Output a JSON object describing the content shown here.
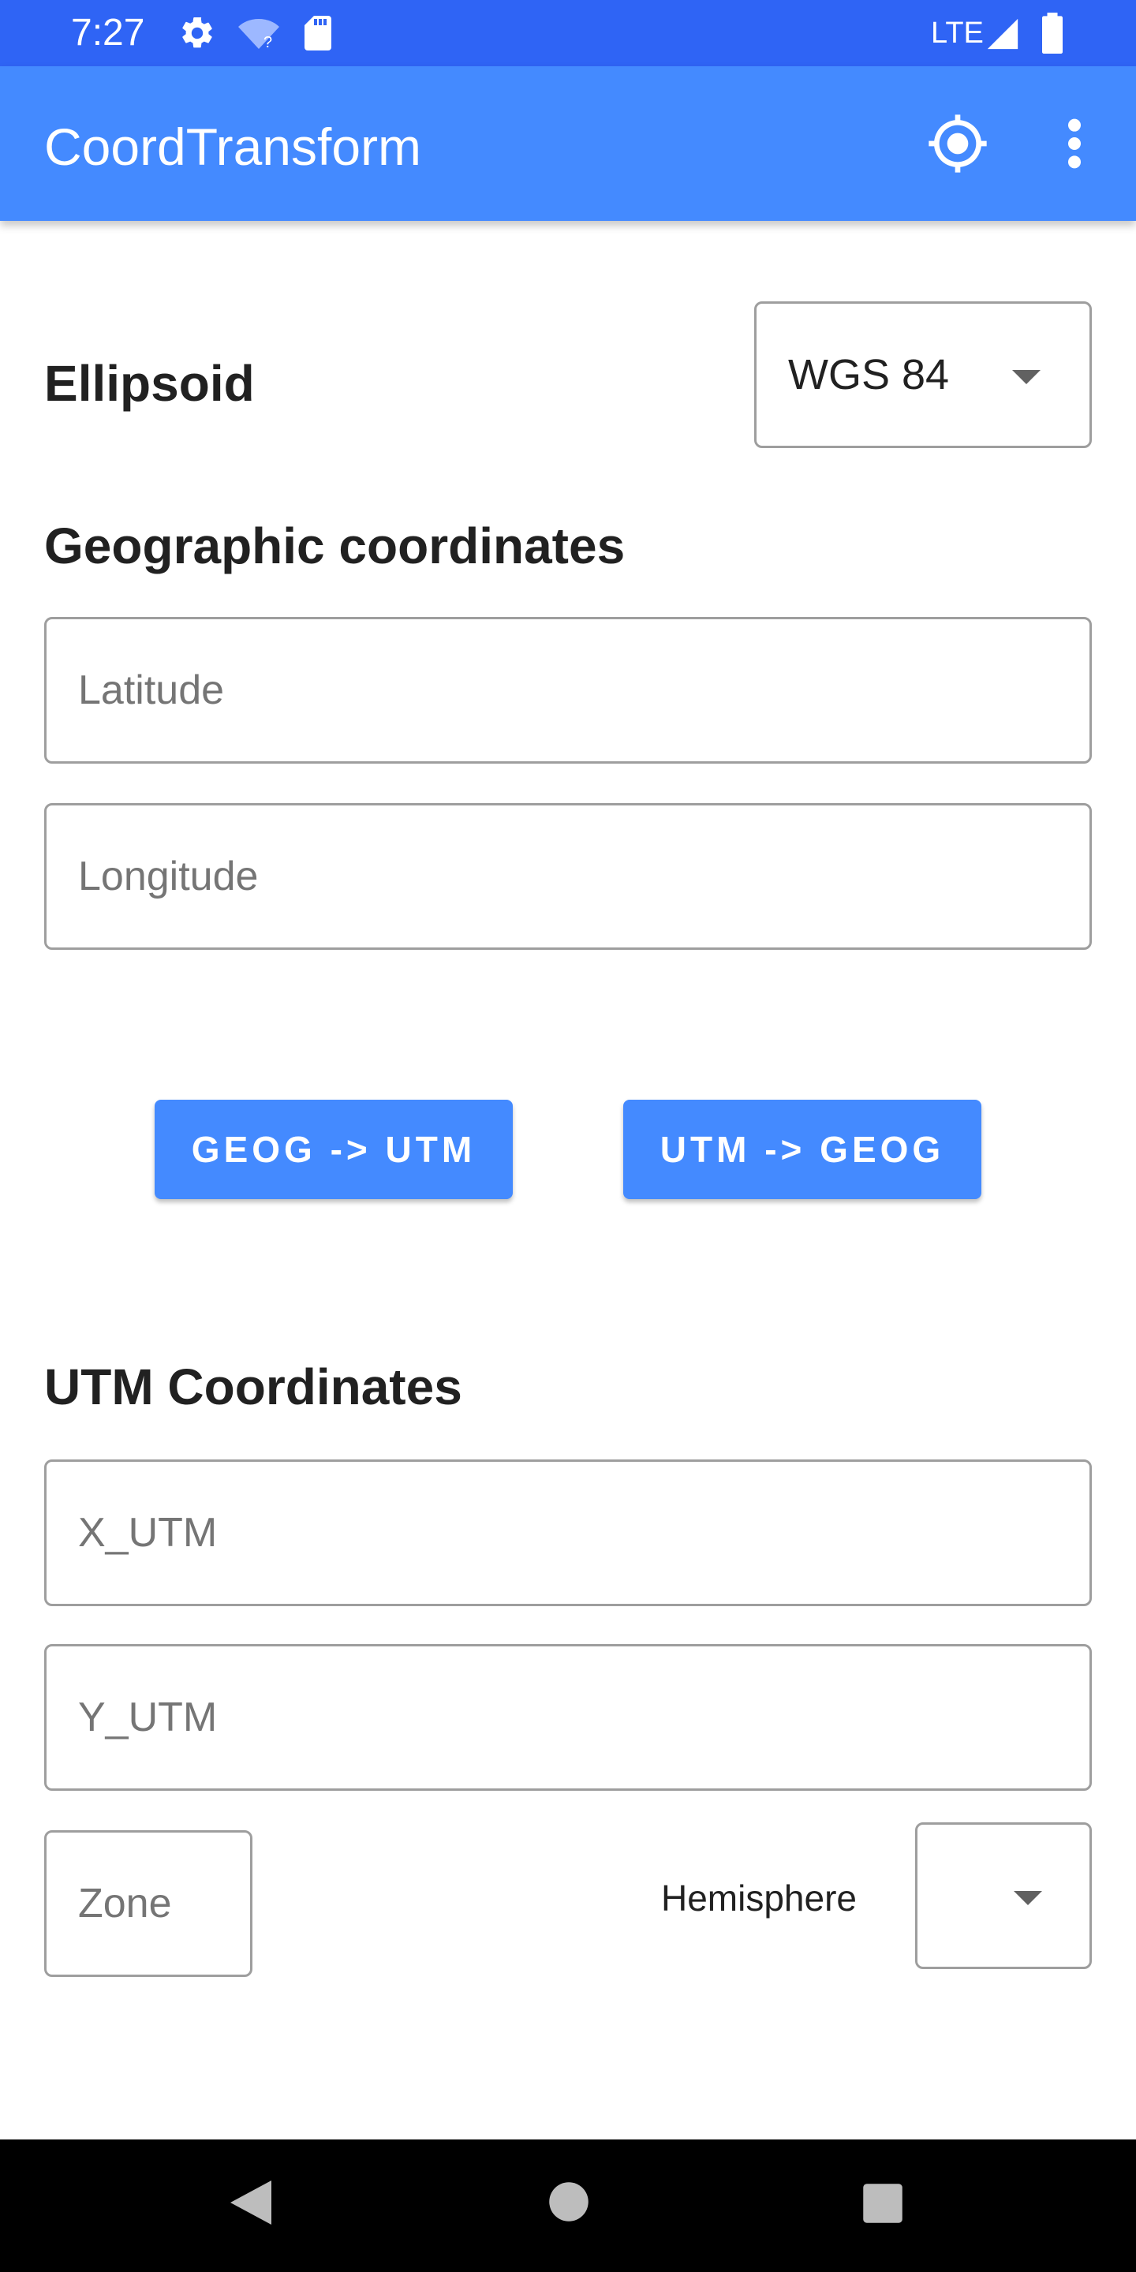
{
  "status_bar": {
    "time": "7:27",
    "network": "LTE",
    "icons": [
      "settings-icon",
      "wifi-unknown-icon",
      "sd-card-icon",
      "signal-icon",
      "battery-icon"
    ]
  },
  "app_bar": {
    "title": "CoordTransform",
    "actions": [
      "my-location-icon",
      "more-vert-icon"
    ]
  },
  "ellipsoid": {
    "label": "Ellipsoid",
    "selected": "WGS 84"
  },
  "geographic": {
    "heading": "Geographic coordinates",
    "latitude_placeholder": "Latitude",
    "latitude_value": "",
    "longitude_placeholder": "Longitude",
    "longitude_value": ""
  },
  "buttons": {
    "geog_to_utm": "GEOG -> UTM",
    "utm_to_geog": "UTM -> GEOG"
  },
  "utm": {
    "heading": "UTM Coordinates",
    "x_placeholder": "X_UTM",
    "x_value": "",
    "y_placeholder": "Y_UTM",
    "y_value": "",
    "zone_placeholder": "Zone",
    "zone_value": "",
    "hemisphere_label": "Hemisphere",
    "hemisphere_selected": ""
  },
  "nav_bar": {
    "buttons": [
      "back-icon",
      "home-icon",
      "recents-icon"
    ]
  },
  "colors": {
    "status_bar": "#2f64f5",
    "primary": "#448aff",
    "border": "#9e9e9e"
  }
}
